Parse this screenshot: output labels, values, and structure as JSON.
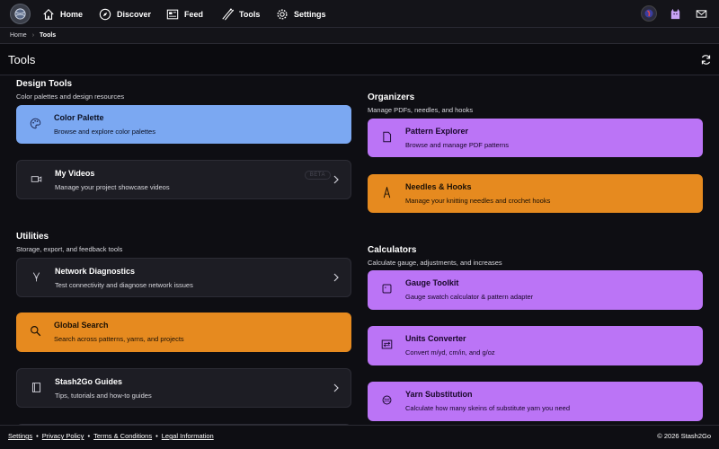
{
  "nav": {
    "items": [
      {
        "label": "Home",
        "icon": "home-icon"
      },
      {
        "label": "Discover",
        "icon": "compass-icon"
      },
      {
        "label": "Feed",
        "icon": "feed-icon"
      },
      {
        "label": "Tools",
        "icon": "needles-icon"
      },
      {
        "label": "Settings",
        "icon": "gear-icon"
      }
    ]
  },
  "breadcrumb": {
    "home": "Home",
    "separator": "›",
    "current": "Tools"
  },
  "page": {
    "title": "Tools"
  },
  "sections": {
    "design": {
      "title": "Design Tools",
      "desc": "Color palettes and design resources"
    },
    "organizers": {
      "title": "Organizers",
      "desc": "Manage PDFs, needles, and hooks"
    },
    "utilities": {
      "title": "Utilities",
      "desc": "Storage, export, and feedback tools"
    },
    "calculators": {
      "title": "Calculators",
      "desc": "Calculate gauge, adjustments, and increases"
    }
  },
  "cards": {
    "color_palette": {
      "title": "Color Palette",
      "desc": "Browse and explore color palettes"
    },
    "my_videos": {
      "title": "My Videos",
      "desc": "Manage your project showcase videos",
      "badge": "BETA"
    },
    "pattern_explorer": {
      "title": "Pattern Explorer",
      "desc": "Browse and manage PDF patterns"
    },
    "needles_hooks": {
      "title": "Needles & Hooks",
      "desc": "Manage your knitting needles and crochet hooks"
    },
    "network_diagnostics": {
      "title": "Network Diagnostics",
      "desc": "Test connectivity and diagnose network issues"
    },
    "global_search": {
      "title": "Global Search",
      "desc": "Search across patterns, yarns, and projects"
    },
    "guides": {
      "title": "Stash2Go Guides",
      "desc": "Tips, tutorials and how-to guides"
    },
    "gauge_toolkit": {
      "title": "Gauge Toolkit",
      "desc": "Gauge swatch calculator & pattern adapter"
    },
    "units_converter": {
      "title": "Units Converter",
      "desc": "Convert m/yd, cm/in, and g/oz"
    },
    "yarn_substitution": {
      "title": "Yarn Substitution",
      "desc": "Calculate how many skeins of substitute yarn you need"
    }
  },
  "footer": {
    "settings": "Settings",
    "privacy": "Privacy Policy",
    "terms": "Terms & Conditions",
    "legal": "Legal Information",
    "sep": "•",
    "copyright": "© 2026 Stash2Go"
  },
  "colors": {
    "blue": "#7ba8f2",
    "orange": "#e68a1f",
    "purple": "#bb74f6",
    "background": "#0e0e13"
  }
}
